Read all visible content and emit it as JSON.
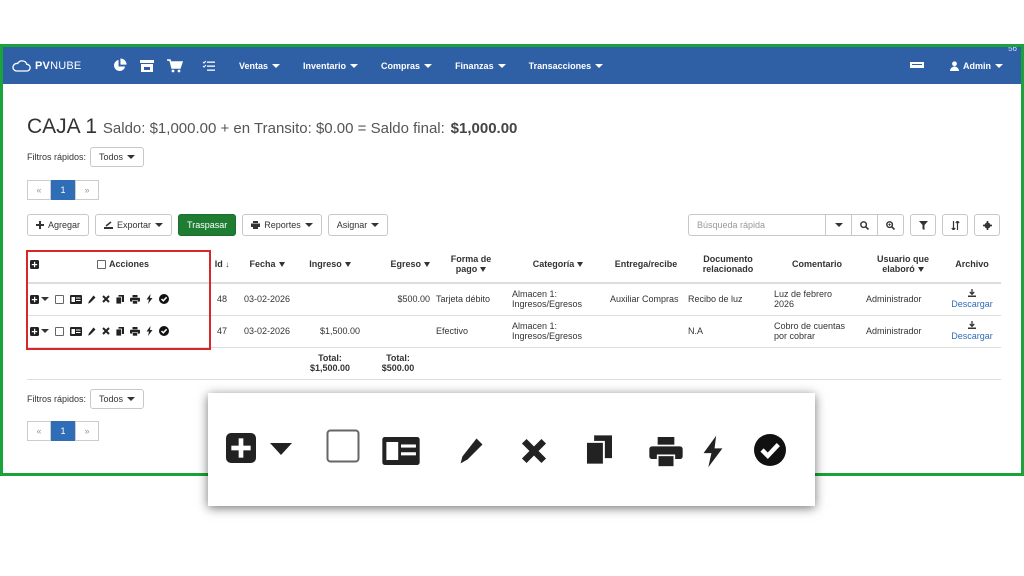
{
  "navbar": {
    "brand_bold": "PV",
    "brand_light": "NUBE",
    "menu": [
      "Ventas",
      "Inventario",
      "Compras",
      "Finanzas",
      "Transacciones"
    ],
    "admin_label": "Admin",
    "corner": "56",
    "bg_color": "#2f5fa4",
    "icons": [
      "pie-chart-icon",
      "store-icon",
      "cart-icon",
      "checklist-icon",
      "keyboard-icon",
      "user-icon"
    ]
  },
  "header": {
    "caja": "CAJA 1",
    "saldo_text": "Saldo: $1,000.00 + en Transito: $0.00 = Saldo final:",
    "saldo_final": "$1,000.00"
  },
  "filtros": {
    "label": "Filtros rápidos:",
    "value": "Todos"
  },
  "pager": {
    "prev": "«",
    "page": "1",
    "next": "»"
  },
  "toolbar": {
    "agregar": "Agregar",
    "exportar": "Exportar",
    "traspasar": "Traspasar",
    "reportes": "Reportes",
    "asignar": "Asignar"
  },
  "search": {
    "placeholder": "Búsqueda rápida"
  },
  "table": {
    "headers": {
      "acciones": "Acciones",
      "id": "Id",
      "fecha": "Fecha",
      "ingreso": "Ingreso",
      "egreso": "Egreso",
      "forma_pago_1": "Forma de",
      "forma_pago_2": "pago",
      "categoria": "Categoría",
      "entrega": "Entrega/recibe",
      "documento_1": "Documento",
      "documento_2": "relacionado",
      "comentario": "Comentario",
      "usuario_1": "Usuario que",
      "usuario_2": "elaboró",
      "archivo": "Archivo"
    },
    "rows": [
      {
        "id": "48",
        "fecha": "03-02-2026",
        "ingreso": "",
        "egreso": "$500.00",
        "forma_pago": "Tarjeta débito",
        "categoria_1": "Almacen 1:",
        "categoria_2": "Ingresos/Egresos",
        "entrega": "Auxiliar Compras",
        "documento": "Recibo de luz",
        "comentario_1": "Luz de febrero",
        "comentario_2": "2026",
        "usuario": "Administrador",
        "archivo": "Descargar"
      },
      {
        "id": "47",
        "fecha": "03-02-2026",
        "ingreso": "$1,500.00",
        "egreso": "",
        "forma_pago": "Efectivo",
        "categoria_1": "Almacen 1:",
        "categoria_2": "Ingresos/Egresos",
        "entrega": "",
        "documento": "N.A",
        "comentario_1": "Cobro de cuentas",
        "comentario_2": "por cobrar",
        "usuario": "Administrador",
        "archivo": "Descargar"
      }
    ],
    "totals": {
      "ingreso_label": "Total:",
      "ingreso_value": "$1,500.00",
      "egreso_label": "Total:",
      "egreso_value": "$500.00"
    }
  },
  "filtros_bottom": {
    "label": "Filtros rápidos:",
    "value": "Todos"
  },
  "pager_bottom": {
    "prev": "«",
    "page": "1",
    "next": "»"
  },
  "highlight_color": "#d62828",
  "frame_color": "#1aa33a"
}
